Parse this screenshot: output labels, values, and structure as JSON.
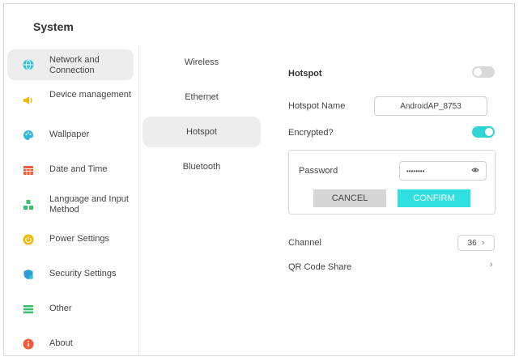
{
  "app": {
    "title": "System"
  },
  "sidebar": {
    "items": [
      {
        "label": "Network and Connection",
        "icon": "globe-icon",
        "color": "#2fc6d4",
        "active": true
      },
      {
        "label": "Device management",
        "icon": "speaker-icon",
        "color": "#f5b800"
      },
      {
        "label": "Wallpaper",
        "icon": "palette-icon",
        "color": "#2fb8d8"
      },
      {
        "label": "Date and Time",
        "icon": "calendar-icon",
        "color": "#f05a3a"
      },
      {
        "label": "Language and Input Method",
        "icon": "language-icon",
        "color": "#3cbf6a"
      },
      {
        "label": "Power Settings",
        "icon": "power-icon",
        "color": "#f5b800"
      },
      {
        "label": "Security Settings",
        "icon": "shield-icon",
        "color": "#2f9ad8"
      },
      {
        "label": "Other",
        "icon": "list-icon",
        "color": "#3cbf6a"
      },
      {
        "label": "About",
        "icon": "info-icon",
        "color": "#f05a3a"
      }
    ]
  },
  "subnav": {
    "items": [
      {
        "label": "Wireless"
      },
      {
        "label": "Ethernet"
      },
      {
        "label": "Hotspot",
        "active": true
      },
      {
        "label": "Bluetooth"
      }
    ]
  },
  "hotspot": {
    "title": "Hotspot",
    "enabled": false,
    "name_label": "Hotspot Name",
    "name_value": "AndroidAP_8753",
    "encrypted_label": "Encrypted?",
    "encrypted": true,
    "password_label": "Password",
    "password_value": "••••••••",
    "cancel_label": "CANCEL",
    "confirm_label": "CONFIRM",
    "channel_label": "Channel",
    "channel_value": "36",
    "qr_label": "QR Code Share"
  },
  "colors": {
    "accent": "#2fe0e0"
  }
}
